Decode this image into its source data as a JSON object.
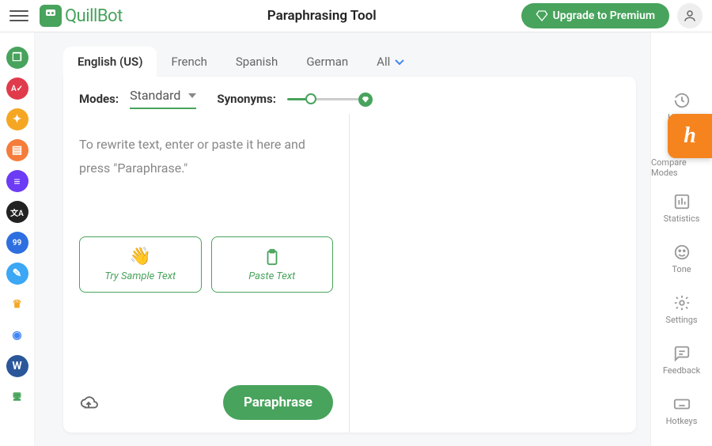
{
  "header": {
    "logo_text": "QuillBot",
    "title": "Paraphrasing Tool",
    "upgrade_label": "Upgrade to Premium"
  },
  "left_rail": {
    "items": [
      {
        "name": "paraphraser-icon",
        "bg": "#48a35c",
        "glyph": "❐"
      },
      {
        "name": "grammar-icon",
        "bg": "#e03b4b",
        "glyph": "A✓"
      },
      {
        "name": "cowriter-icon",
        "bg": "#f5a623",
        "glyph": "✦"
      },
      {
        "name": "summarizer-icon",
        "bg": "#f57c3b",
        "glyph": "▤"
      },
      {
        "name": "citation-icon",
        "bg": "#6c3bf5",
        "glyph": "≡"
      },
      {
        "name": "translator-icon",
        "bg": "#222",
        "glyph": "文A"
      },
      {
        "name": "plagiarism-icon",
        "bg": "#2d6fe0",
        "glyph": "99"
      },
      {
        "name": "flow-icon",
        "bg": "#3ba7f5",
        "glyph": "✎"
      },
      {
        "name": "premium-icon",
        "bg": "transparent",
        "glyph": "♛",
        "color": "#f5a623"
      },
      {
        "name": "chrome-icon",
        "bg": "#fff",
        "glyph": "◉",
        "color": "#4285f4"
      },
      {
        "name": "word-icon",
        "bg": "#2b579a",
        "glyph": "W"
      },
      {
        "name": "desktop-icon",
        "bg": "transparent",
        "glyph": "🖥",
        "color": "#48a35c"
      }
    ]
  },
  "tabs": {
    "items": [
      "English (US)",
      "French",
      "Spanish",
      "German",
      "All"
    ],
    "active_index": 0
  },
  "controls": {
    "modes_label": "Modes:",
    "mode_value": "Standard",
    "synonyms_label": "Synonyms:"
  },
  "editor": {
    "placeholder": "To rewrite text, enter or paste it here and press \"Paraphrase.\"",
    "sample_label": "Try Sample Text",
    "paste_label": "Paste Text",
    "paraphrase_button": "Paraphrase"
  },
  "right_rail": {
    "items": [
      "History",
      "Compare Modes",
      "Statistics",
      "Tone",
      "Settings",
      "Feedback",
      "Hotkeys"
    ]
  },
  "float_badge": "h"
}
